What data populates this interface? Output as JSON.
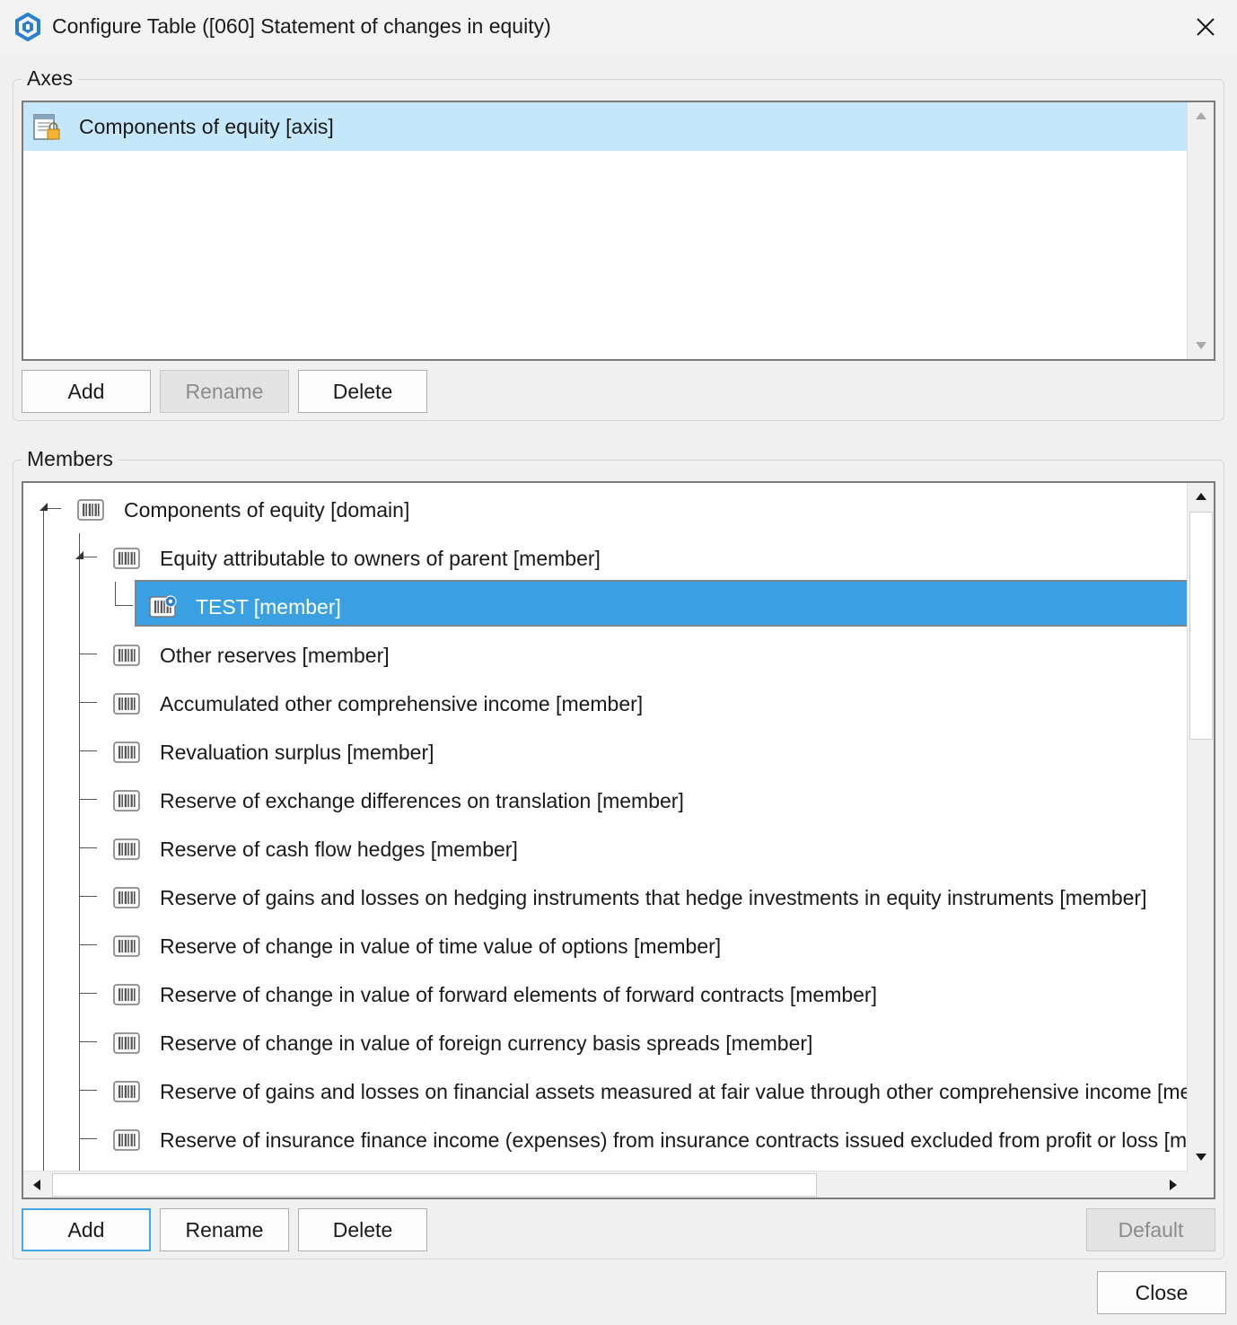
{
  "window": {
    "title": "Configure Table ([060] Statement of changes in equity)",
    "icon": "app-logo-icon",
    "close_glyph": "✕"
  },
  "axes": {
    "legend": "Axes",
    "items": [
      {
        "label": "Components of equity [axis]",
        "icon": "locked-document-icon",
        "selected": true
      }
    ],
    "buttons": {
      "add": "Add",
      "rename": "Rename",
      "delete": "Delete"
    },
    "rename_enabled": false
  },
  "members": {
    "legend": "Members",
    "tree": [
      {
        "label": "Components of equity [domain]",
        "level": 0,
        "expanded": true
      },
      {
        "label": "Equity attributable to owners of parent [member]",
        "level": 1,
        "expanded": true
      },
      {
        "label": "TEST [member]",
        "level": 2,
        "selected": true,
        "icon": "custom-member-icon"
      },
      {
        "label": "Other reserves [member]",
        "level": 1
      },
      {
        "label": "Accumulated other comprehensive income [member]",
        "level": 1
      },
      {
        "label": "Revaluation surplus [member]",
        "level": 1
      },
      {
        "label": "Reserve of exchange differences on translation [member]",
        "level": 1
      },
      {
        "label": "Reserve of cash flow hedges [member]",
        "level": 1
      },
      {
        "label": "Reserve of gains and losses on hedging instruments that hedge investments in equity instruments [member]",
        "level": 1
      },
      {
        "label": "Reserve of change in value of time value of options [member]",
        "level": 1
      },
      {
        "label": "Reserve of change in value of forward elements of forward contracts [member]",
        "level": 1
      },
      {
        "label": "Reserve of change in value of foreign currency basis spreads [member]",
        "level": 1
      },
      {
        "label": "Reserve of gains and losses on financial assets measured at fair value through other comprehensive income [member]",
        "level": 1
      },
      {
        "label": "Reserve of insurance finance income (expenses) from insurance contracts issued excluded from profit or loss [member]",
        "level": 1
      }
    ],
    "buttons": {
      "add": "Add",
      "rename": "Rename",
      "delete": "Delete",
      "default": "Default"
    },
    "default_enabled": false
  },
  "footer": {
    "close": "Close"
  },
  "colors": {
    "selection_light": "#c5e7fa",
    "selection_strong": "#3aa0e2",
    "focus_border": "#46a8ea",
    "logo_blue": "#2a7fd4"
  }
}
